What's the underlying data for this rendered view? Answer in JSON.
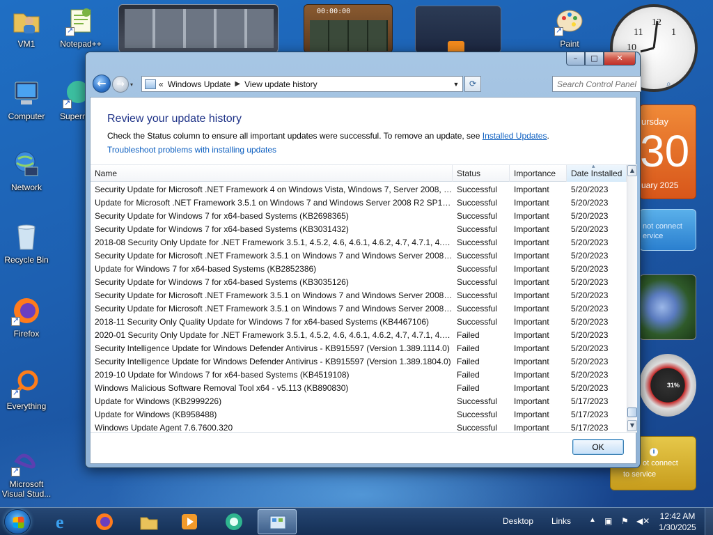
{
  "desktop_icons": [
    {
      "label": "VM1"
    },
    {
      "label": "Notepad++"
    },
    {
      "label": "Computer"
    },
    {
      "label": "Superm"
    },
    {
      "label": "Network"
    },
    {
      "label": "Recycle Bin"
    },
    {
      "label": "Firefox"
    },
    {
      "label": "Everything"
    },
    {
      "label": "Microsoft Visual Stud..."
    },
    {
      "label": "Paint"
    }
  ],
  "gadgets": {
    "media_timer": "00:00:00",
    "calendar_day_partial": "ursday",
    "calendar_date_partial": "30",
    "calendar_month_partial": "uary 2025",
    "weather_msg_1": "not connect",
    "weather_msg_1b": "ervice",
    "weather_msg_2": "ot connect",
    "weather_msg_2b": "to service",
    "cpu_meter": "31%"
  },
  "window": {
    "address": {
      "crumb_prefix": "«",
      "crumb_1": "Windows Update",
      "crumb_2": "View update history"
    },
    "search_placeholder": "Search Control Panel",
    "title": "Review your update history",
    "description": "Check the Status column to ensure all important updates were successful. To remove an update, see ",
    "installed_updates_link": "Installed Updates",
    "description_end": ".",
    "troubleshoot_link": "Troubleshoot problems with installing updates",
    "columns": {
      "name": "Name",
      "status": "Status",
      "importance": "Importance",
      "date": "Date Installed"
    },
    "rows": [
      {
        "name": "Security Update for Microsoft .NET Framework 4 on Windows Vista, Windows 7, Server 2008, Ser...",
        "status": "Successful",
        "importance": "Important",
        "date": "5/20/2023"
      },
      {
        "name": "Update for Microsoft .NET Framework 3.5.1 on Windows 7 and Windows Server 2008 R2 SP1 for ...",
        "status": "Successful",
        "importance": "Important",
        "date": "5/20/2023"
      },
      {
        "name": "Security Update for Windows 7 for x64-based Systems (KB2698365)",
        "status": "Successful",
        "importance": "Important",
        "date": "5/20/2023"
      },
      {
        "name": "Security Update for Windows 7 for x64-based Systems (KB3031432)",
        "status": "Successful",
        "importance": "Important",
        "date": "5/20/2023"
      },
      {
        "name": "2018-08 Security Only Update for .NET Framework 3.5.1, 4.5.2, 4.6, 4.6.1, 4.6.2, 4.7, 4.7.1, 4.7.2 for ...",
        "status": "Successful",
        "importance": "Important",
        "date": "5/20/2023"
      },
      {
        "name": "Security Update for Microsoft .NET Framework 3.5.1 on Windows 7 and Windows Server 2008 R2...",
        "status": "Successful",
        "importance": "Important",
        "date": "5/20/2023"
      },
      {
        "name": "Update for Windows 7 for x64-based Systems (KB2852386)",
        "status": "Successful",
        "importance": "Important",
        "date": "5/20/2023"
      },
      {
        "name": "Security Update for Windows 7 for x64-based Systems (KB3035126)",
        "status": "Successful",
        "importance": "Important",
        "date": "5/20/2023"
      },
      {
        "name": "Security Update for Microsoft .NET Framework 3.5.1 on Windows 7 and Windows Server 2008 R2...",
        "status": "Successful",
        "importance": "Important",
        "date": "5/20/2023"
      },
      {
        "name": "Security Update for Microsoft .NET Framework 3.5.1 on Windows 7 and Windows Server 2008 R2...",
        "status": "Successful",
        "importance": "Important",
        "date": "5/20/2023"
      },
      {
        "name": "2018-11 Security Only Quality Update for Windows 7 for x64-based Systems (KB4467106)",
        "status": "Successful",
        "importance": "Important",
        "date": "5/20/2023"
      },
      {
        "name": "2020-01 Security Only Update for .NET Framework 3.5.1, 4.5.2, 4.6, 4.6.1, 4.6.2, 4.7, 4.7.1, 4.7.2, 4.8...",
        "status": "Failed",
        "importance": "Important",
        "date": "5/20/2023"
      },
      {
        "name": "Security Intelligence Update for Windows Defender Antivirus - KB915597 (Version 1.389.1114.0)",
        "status": "Failed",
        "importance": "Important",
        "date": "5/20/2023"
      },
      {
        "name": "Security Intelligence Update for Windows Defender Antivirus - KB915597 (Version 1.389.1804.0)",
        "status": "Failed",
        "importance": "Important",
        "date": "5/20/2023"
      },
      {
        "name": "2019-10 Update for Windows 7 for x64-based Systems (KB4519108)",
        "status": "Failed",
        "importance": "Important",
        "date": "5/20/2023"
      },
      {
        "name": "Windows Malicious Software Removal Tool x64 - v5.113 (KB890830)",
        "status": "Failed",
        "importance": "Important",
        "date": "5/20/2023"
      },
      {
        "name": "Update for Windows (KB2999226)",
        "status": "Successful",
        "importance": "Important",
        "date": "5/17/2023"
      },
      {
        "name": "Update for Windows (KB958488)",
        "status": "Successful",
        "importance": "Important",
        "date": "5/17/2023"
      },
      {
        "name": "Windows Update Agent 7.6.7600.320",
        "status": "Successful",
        "importance": "Important",
        "date": "5/17/2023"
      }
    ],
    "ok_label": "OK"
  },
  "taskbar": {
    "desktop_label": "Desktop",
    "links_label": "Links",
    "time": "12:42 AM",
    "date": "1/30/2025"
  }
}
